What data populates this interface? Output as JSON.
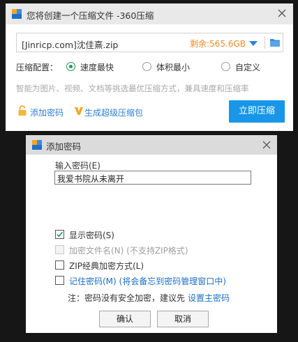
{
  "compress_window": {
    "title": "您将创建一个压缩文件 -360压缩",
    "path": "[Jinricp.com]沈佳熹.zip",
    "free_space": "剩余:565.6GB",
    "config_label": "压缩配置：",
    "options": [
      {
        "label": "速度最快",
        "selected": true
      },
      {
        "label": "体积最小",
        "selected": false
      },
      {
        "label": "自定义",
        "selected": false
      }
    ],
    "hint": "智能为图片、视频、文档等挑选最优压缩方式，兼具速度和压缩率",
    "add_password": "添加密码",
    "generate_sfx": "生成超级压缩包",
    "compress_button": "立即压缩",
    "accent_color": "#1896e8"
  },
  "password_dialog": {
    "title": "添加密码",
    "input_label": "输入密码(E)",
    "password_value": "我爱书院从未离开",
    "checkboxes": [
      {
        "label": "显示密码(S)",
        "checked": true,
        "enabled": true
      },
      {
        "label": "加密文件名(N)  (不支持ZIP格式)",
        "checked": false,
        "enabled": false
      },
      {
        "label": "ZIP经典加密方式(L)",
        "checked": false,
        "enabled": true
      },
      {
        "label": "记住密码(M)  (将会备忘到密码管理窗口中)",
        "checked": false,
        "enabled": true
      }
    ],
    "note": "注：密码没有安全加密，建议先",
    "note_link": "设置主密码",
    "ok_button": "确认",
    "cancel_button": "取消"
  }
}
